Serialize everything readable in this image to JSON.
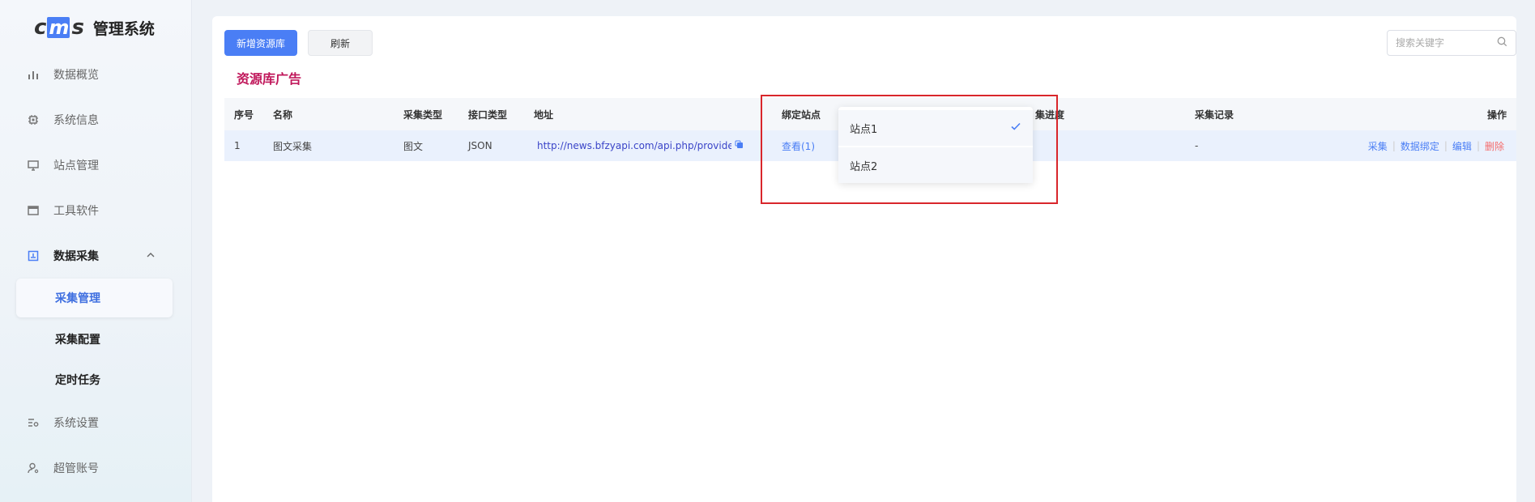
{
  "brand": {
    "logo_c": "c",
    "logo_m": "m",
    "logo_s": "s",
    "title": "管理系统"
  },
  "sidebar": {
    "items": [
      {
        "label": "数据概览",
        "icon": "bar-chart-icon"
      },
      {
        "label": "系统信息",
        "icon": "chip-icon"
      },
      {
        "label": "站点管理",
        "icon": "monitor-icon"
      },
      {
        "label": "工具软件",
        "icon": "window-icon"
      },
      {
        "label": "数据采集",
        "icon": "collect-icon",
        "expanded": true
      },
      {
        "label": "系统设置",
        "icon": "settings-icon"
      },
      {
        "label": "超管账号",
        "icon": "user-icon"
      }
    ],
    "sub_items": [
      {
        "label": "采集管理",
        "active": true
      },
      {
        "label": "采集配置"
      },
      {
        "label": "定时任务"
      }
    ]
  },
  "toolbar": {
    "add_label": "新增资源库",
    "refresh_label": "刷新"
  },
  "search": {
    "placeholder": "搜索关键字"
  },
  "section_title": "资源库广告",
  "table": {
    "columns": {
      "index": "序号",
      "name": "名称",
      "collect_type": "采集类型",
      "api_type": "接口类型",
      "address": "地址",
      "bind_site": "绑定站点",
      "progress": "集进度",
      "record": "采集记录",
      "ops": "操作"
    },
    "rows": [
      {
        "index": "1",
        "name": "图文采集",
        "collect_type": "图文",
        "api_type": "JSON",
        "address": "http://news.bfzyapi.com/api.php/provide/",
        "bind_site": "查看(1)",
        "record": "-",
        "ops": {
          "collect": "采集",
          "bind": "数据绑定",
          "edit": "编辑",
          "delete": "删除"
        }
      }
    ]
  },
  "dropdown": {
    "options": [
      {
        "label": "站点1",
        "selected": true
      },
      {
        "label": "站点2",
        "selected": false
      }
    ]
  },
  "colors": {
    "primary": "#4a7ef5",
    "title": "#c0185b",
    "danger": "#f56c6c",
    "highlight": "#d9262b"
  }
}
